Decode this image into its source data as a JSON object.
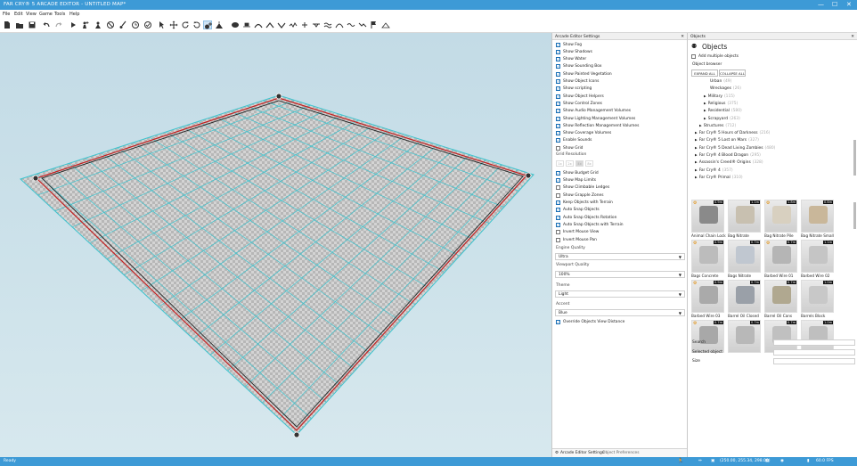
{
  "titlebar": {
    "title": "FAR CRY® 5 ARCADE EDITOR - UNTITLED MAP*",
    "minimize": "—",
    "maximize": "☐",
    "close": "✕"
  },
  "menu": [
    "File",
    "Edit",
    "View",
    "Game",
    "Tools",
    "Help"
  ],
  "settings_panel": {
    "title": "Arcade Editor Settings",
    "close": "✕",
    "checkboxes_top": [
      {
        "label": "Show Fog",
        "checked": true
      },
      {
        "label": "Show Shadows",
        "checked": true
      },
      {
        "label": "Show Water",
        "checked": true
      },
      {
        "label": "Show Sounding Box",
        "checked": true
      },
      {
        "label": "Show Painted Vegetation",
        "checked": true
      },
      {
        "label": "Show Object Icons",
        "checked": true
      },
      {
        "label": "Show scripting",
        "checked": true
      },
      {
        "label": "Show Object Helpers",
        "checked": true
      },
      {
        "label": "Show Control Zones",
        "checked": true
      },
      {
        "label": "Show Audio Management Volumes",
        "checked": true
      },
      {
        "label": "Show Lighting Management Volumes",
        "checked": true
      },
      {
        "label": "Show Reflection Management Volumes",
        "checked": true
      },
      {
        "label": "Show Coverage Volumes",
        "checked": true
      },
      {
        "label": "Enable Sounds",
        "checked": true
      },
      {
        "label": "Show Grid",
        "checked": false
      }
    ],
    "grid_resolution_label": "Grid Resolution",
    "grid_resolution_options": [
      "1x",
      "2x",
      "4x",
      "8x"
    ],
    "checkboxes_bottom": [
      {
        "label": "Show Budget Grid",
        "checked": true
      },
      {
        "label": "Show Map Limits",
        "checked": true
      },
      {
        "label": "Show Climbable Ledges",
        "checked": false
      },
      {
        "label": "Show Grapple Zones",
        "checked": false
      },
      {
        "label": "Keep Objects with Terrain",
        "checked": true
      },
      {
        "label": "Auto Snap Objects",
        "checked": true
      },
      {
        "label": "Auto Snap Objects Rotation",
        "checked": true
      },
      {
        "label": "Auto Snap Objects with Terrain",
        "checked": true
      },
      {
        "label": "Invert Mouse View",
        "checked": false
      },
      {
        "label": "Invert Mouse Pan",
        "checked": false
      }
    ],
    "dropdowns": [
      {
        "label": "Engine Quality",
        "value": "Ultra"
      },
      {
        "label": "Viewport Quality",
        "value": "100%"
      },
      {
        "label": "Theme",
        "value": "Light"
      },
      {
        "label": "Accent",
        "value": "Blue"
      }
    ],
    "override_checkbox": {
      "label": "Override Objects View Distance",
      "checked": true
    },
    "footer_tabs": [
      "Arcade Editor Settings",
      "Object Preferences"
    ]
  },
  "objects_panel": {
    "title": "Objects",
    "close": "✕",
    "heading": "Objects",
    "add_multiple": "Add multiple objects",
    "browser_label": "Object browser",
    "expand_all": "EXPAND ALL",
    "collapse_all": "COLLAPSE ALL",
    "tree": [
      {
        "label": "Urban",
        "count": "(49)",
        "indent": 2,
        "arrow": ""
      },
      {
        "label": "Wreckages",
        "count": "(26)",
        "indent": 2,
        "arrow": ""
      },
      {
        "label": "Military",
        "count": "(115)",
        "indent": 1,
        "arrow": "▶"
      },
      {
        "label": "Religious",
        "count": "(375)",
        "indent": 1,
        "arrow": "▶"
      },
      {
        "label": "Residential",
        "count": "(580)",
        "indent": 1,
        "arrow": "▶"
      },
      {
        "label": "Scrapyard",
        "count": "(263)",
        "indent": 1,
        "arrow": "▶"
      },
      {
        "label": "Structures",
        "count": "(712)",
        "indent": 0,
        "arrow": "▶"
      },
      {
        "label": "Far Cry® 5 Hours of Darkness",
        "count": "(216)",
        "indent": -1,
        "arrow": "▶"
      },
      {
        "label": "Far Cry® 5 Lost on Mars",
        "count": "(327)",
        "indent": -1,
        "arrow": "▶"
      },
      {
        "label": "Far Cry® 5 Dead Living Zombies",
        "count": "(480)",
        "indent": -1,
        "arrow": "▶"
      },
      {
        "label": "Far Cry® 4 Blood Dragon",
        "count": "(295)",
        "indent": -1,
        "arrow": "▶"
      },
      {
        "label": "Assassin's Creed® Origins",
        "count": "(328)",
        "indent": -1,
        "arrow": "▶"
      },
      {
        "label": "Far Cry® 4",
        "count": "(357)",
        "indent": -1,
        "arrow": "▶"
      },
      {
        "label": "Far Cry® Primal",
        "count": "(310)",
        "indent": -1,
        "arrow": "▶"
      }
    ],
    "thumbnails": [
      {
        "name": "Animal Chain Lock",
        "size": "0.9m"
      },
      {
        "name": "Bag Nitrate",
        "size": "1.1m"
      },
      {
        "name": "Bag Nitrate Pile",
        "size": "1.8m"
      },
      {
        "name": "Bag Nitrate Small",
        "size": "0.6m"
      },
      {
        "name": "Bags Concrete",
        "size": "0.9m"
      },
      {
        "name": "Bags Nitrate",
        "size": "0.7m"
      },
      {
        "name": "Barbed Wire 01",
        "size": "0.7m"
      },
      {
        "name": "Barbed Wire 02",
        "size": "1.1m"
      },
      {
        "name": "Barbed Wire 03",
        "size": "0.9m"
      },
      {
        "name": "Barrel Oil Closed",
        "size": "0.7m"
      },
      {
        "name": "Barrel Oil Cans",
        "size": "0.7m"
      },
      {
        "name": "Barrels Block",
        "size": "1.0m"
      },
      {
        "name": "",
        "size": "0.7m"
      },
      {
        "name": "",
        "size": "0.7m"
      },
      {
        "name": "",
        "size": "0.7m"
      },
      {
        "name": "",
        "size": "1.0m"
      }
    ],
    "search_label": "Search",
    "selected_label": "Selected object",
    "size_label": "Size"
  },
  "statusbar": {
    "status": "Ready",
    "coords": "(250.00, 255.34, 298.00)",
    "fps": "60.0 FPS"
  },
  "colors": {
    "accent": "#3d9ad6",
    "grid_line": "#3bc4cf",
    "border_red": "#c42020"
  }
}
